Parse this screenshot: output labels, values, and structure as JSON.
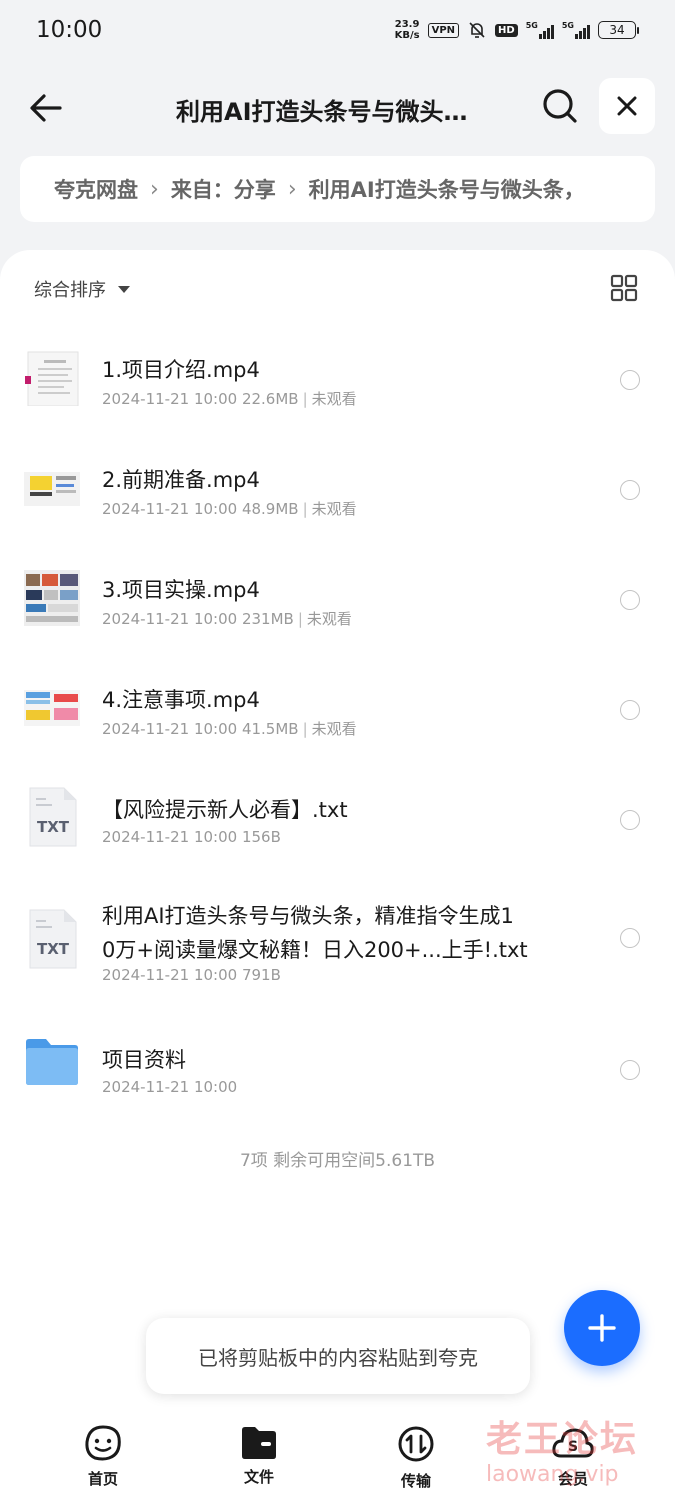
{
  "status_bar": {
    "time": "10:00",
    "net_speed_value": "23.9",
    "net_speed_unit": "KB/s",
    "vpn": "VPN",
    "hd": "HD",
    "sim1": "5G",
    "sim2": "5G",
    "battery": "34"
  },
  "header": {
    "title": "利用AI打造头条号与微头…",
    "icons": {
      "back": "arrow-left-icon",
      "search": "search-icon",
      "close": "close-icon"
    }
  },
  "breadcrumb": {
    "items": [
      "夸克网盘",
      "来自：分享",
      "利用AI打造头条号与微头条，"
    ]
  },
  "toolbar": {
    "sort_label": "综合排序",
    "view_toggle_icon": "grid-view-icon"
  },
  "files": [
    {
      "name": "1.项目介绍.mp4",
      "date": "2024-11-21 10:00",
      "size": "22.6MB",
      "status": "未观看",
      "type": "video"
    },
    {
      "name": "2.前期准备.mp4",
      "date": "2024-11-21 10:00",
      "size": "48.9MB",
      "status": "未观看",
      "type": "video"
    },
    {
      "name": "3.项目实操.mp4",
      "date": "2024-11-21 10:00",
      "size": "231MB",
      "status": "未观看",
      "type": "video"
    },
    {
      "name": "4.注意事项.mp4",
      "date": "2024-11-21 10:00",
      "size": "41.5MB",
      "status": "未观看",
      "type": "video"
    },
    {
      "name": "【风险提示新人必看】.txt",
      "date": "2024-11-21 10:00",
      "size": "156B",
      "type": "txt",
      "icon_label": "TXT"
    },
    {
      "name_line1": "利用AI打造头条号与微头条，精准指令生成1",
      "name_line2": "0万+阅读量爆文秘籍！日入200+...上手!.txt",
      "date": "2024-11-21 10:00",
      "size": "791B",
      "type": "txt",
      "icon_label": "TXT"
    },
    {
      "name": "项目资料",
      "date": "2024-11-21 10:00",
      "type": "folder"
    }
  ],
  "summary": "7项  剩余可用空间5.61TB",
  "toast": "已将剪贴板中的内容粘贴到夸克",
  "fab_icon": "plus-icon",
  "bottom_nav": [
    {
      "label": "首页",
      "icon": "smile-face-icon"
    },
    {
      "label": "文件",
      "icon": "folder-icon"
    },
    {
      "label": "传输",
      "icon": "transfer-icon"
    },
    {
      "label": "会员",
      "icon": "cloud-vip-icon"
    }
  ],
  "watermark": {
    "line1": "老王论坛",
    "line2": "laowang.vip"
  },
  "colors": {
    "accent": "#1b6dff",
    "background": "#f2f3f5",
    "folder": "#5aaaf0"
  }
}
